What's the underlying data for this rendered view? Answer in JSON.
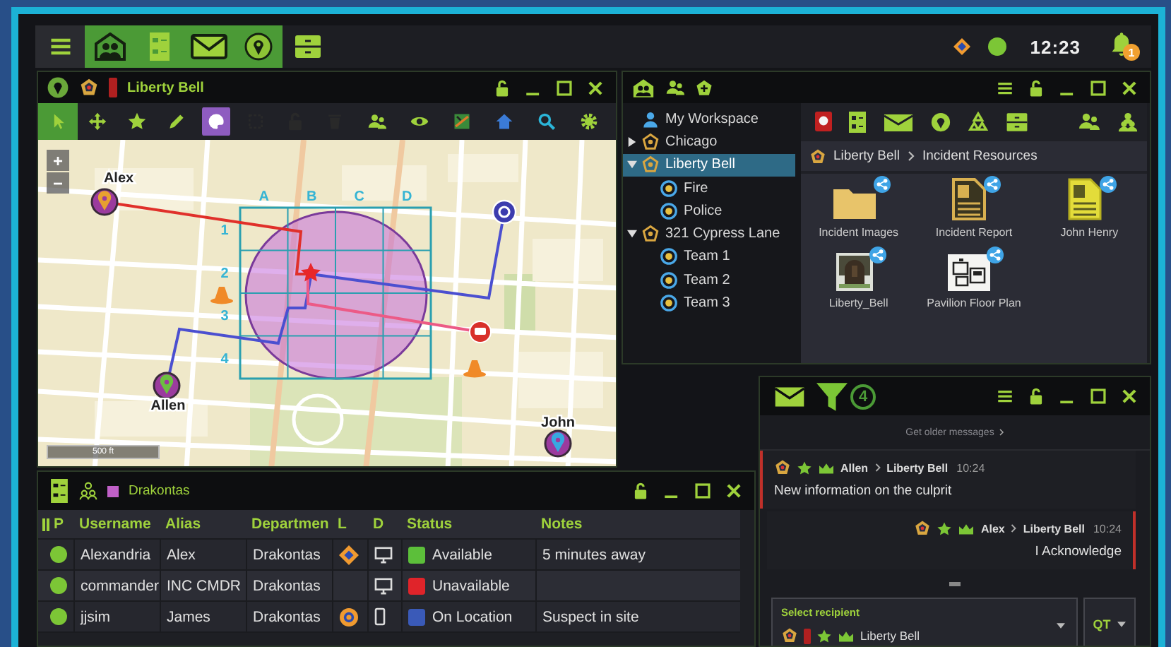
{
  "top_bar": {
    "apps": [
      {
        "kind": "people",
        "selected": true
      },
      {
        "kind": "roster",
        "selected": true
      },
      {
        "kind": "mail",
        "selected": true
      },
      {
        "kind": "map",
        "selected": true
      },
      {
        "kind": "archive",
        "selected": false
      }
    ],
    "clock": "12:23",
    "notifications": "1"
  },
  "map_panel": {
    "title": "Liberty Bell",
    "tools": [
      {
        "kind": "pointer",
        "selected": true,
        "disabled": false
      },
      {
        "kind": "move",
        "selected": false,
        "disabled": false
      },
      {
        "kind": "star",
        "selected": false,
        "disabled": false
      },
      {
        "kind": "pencil",
        "selected": false,
        "disabled": false
      },
      {
        "kind": "palette",
        "selected": true,
        "disabled": false
      },
      {
        "kind": "area",
        "selected": false,
        "disabled": true
      },
      {
        "kind": "lock",
        "selected": false,
        "disabled": true
      },
      {
        "kind": "trash",
        "selected": false,
        "disabled": true
      },
      {
        "kind": "people",
        "selected": false,
        "disabled": false
      },
      {
        "kind": "eye",
        "selected": false,
        "disabled": false
      },
      {
        "kind": "layers",
        "selected": false,
        "disabled": false
      },
      {
        "kind": "home",
        "selected": false,
        "disabled": false
      },
      {
        "kind": "search",
        "selected": false,
        "disabled": false
      },
      {
        "kind": "gear",
        "selected": false,
        "disabled": false
      }
    ],
    "zoom_controls": [
      "+",
      "−"
    ],
    "grid": {
      "columns": [
        "A",
        "B",
        "C",
        "D"
      ],
      "rows": [
        "1",
        "2",
        "3",
        "4"
      ]
    },
    "routes": [
      {
        "color": "#e0302a"
      },
      {
        "color": "#4b4fd0"
      },
      {
        "color": "#4b4fd0"
      },
      {
        "color": "#ec5a86"
      }
    ],
    "markers": [
      {
        "kind": "person",
        "label": "Alex",
        "color": "#e8a030"
      },
      {
        "kind": "person",
        "label": "Allen",
        "color": "#6cc040"
      },
      {
        "kind": "person",
        "label": "John",
        "color": "#38a8e0"
      },
      {
        "kind": "unit"
      },
      {
        "kind": "vehicle"
      },
      {
        "kind": "cone"
      },
      {
        "kind": "cone"
      },
      {
        "kind": "incident"
      }
    ],
    "scale": "500 ft"
  },
  "resources_panel": {
    "tree": [
      {
        "label": "My Workspace",
        "kind": "workspace",
        "selected": false
      },
      {
        "label": "Chicago",
        "kind": "incident",
        "expanded": false,
        "selected": false
      },
      {
        "label": "Liberty Bell",
        "kind": "incident",
        "expanded": true,
        "selected": true,
        "children": [
          {
            "label": "Fire",
            "kind": "unit",
            "selected": false
          },
          {
            "label": "Police",
            "kind": "unit",
            "selected": false
          }
        ]
      },
      {
        "label": "321 Cypress Lane",
        "kind": "incident",
        "expanded": true,
        "selected": false,
        "children": [
          {
            "label": "Team 1",
            "kind": "unit",
            "selected": false
          },
          {
            "label": "Team 2",
            "kind": "unit",
            "selected": false
          },
          {
            "label": "Team 3",
            "kind": "unit",
            "selected": false
          }
        ]
      }
    ],
    "breadcrumb": [
      "Liberty Bell",
      "Incident Resources"
    ],
    "files": [
      {
        "name": "Incident Images",
        "kind": "folder",
        "shared": true
      },
      {
        "name": "Incident Report",
        "kind": "document",
        "shared": true
      },
      {
        "name": "John Henry",
        "kind": "highlighted-document",
        "shared": true
      },
      {
        "name": "Liberty_Bell",
        "shared": true
      },
      {
        "name": "Pavilion Floor Plan",
        "kind": "plan",
        "shared": true
      }
    ]
  },
  "chat_panel": {
    "filter_count": "4",
    "older_messages": "Get older messages",
    "messages": [
      {
        "sender": "Allen",
        "recipient": "Liberty Bell",
        "time": "10:24",
        "text": "New information on the culprit",
        "outgoing": false
      },
      {
        "sender": "Alex",
        "recipient": "Liberty Bell",
        "time": "10:24",
        "text": "I Acknowledge",
        "outgoing": true
      }
    ],
    "recipient_field": {
      "label": "Select recipient",
      "value": "Liberty Bell"
    },
    "quick_text": "QT"
  },
  "roster_panel": {
    "title": "Drakontas",
    "group": {
      "color": "#c060c8"
    },
    "columns": [
      "P",
      "Username",
      "Alias",
      "Departmen",
      "L",
      "D",
      "Status",
      "Notes"
    ],
    "rows": [
      {
        "online": true,
        "username": "Alexandria",
        "alias": "Alex",
        "department": "Drakontas",
        "location": {
          "kind": "diamond"
        },
        "device": {
          "kind": "desktop"
        },
        "status": {
          "label": "Available",
          "color": "#5cbf3a"
        },
        "notes": "5 minutes away"
      },
      {
        "online": true,
        "username": "commander",
        "alias": "INC CMDR",
        "department": "Drakontas",
        "device": {
          "kind": "desktop"
        },
        "status": {
          "label": "Unavailable",
          "color": "#e0242a"
        }
      },
      {
        "online": true,
        "username": "jjsim",
        "alias": "James",
        "department": "Drakontas",
        "location": {
          "kind": "ring"
        },
        "device": {
          "kind": "phone"
        },
        "status": {
          "label": "On Location",
          "color": "#3a5ab8"
        },
        "notes": "Suspect in site"
      }
    ]
  }
}
